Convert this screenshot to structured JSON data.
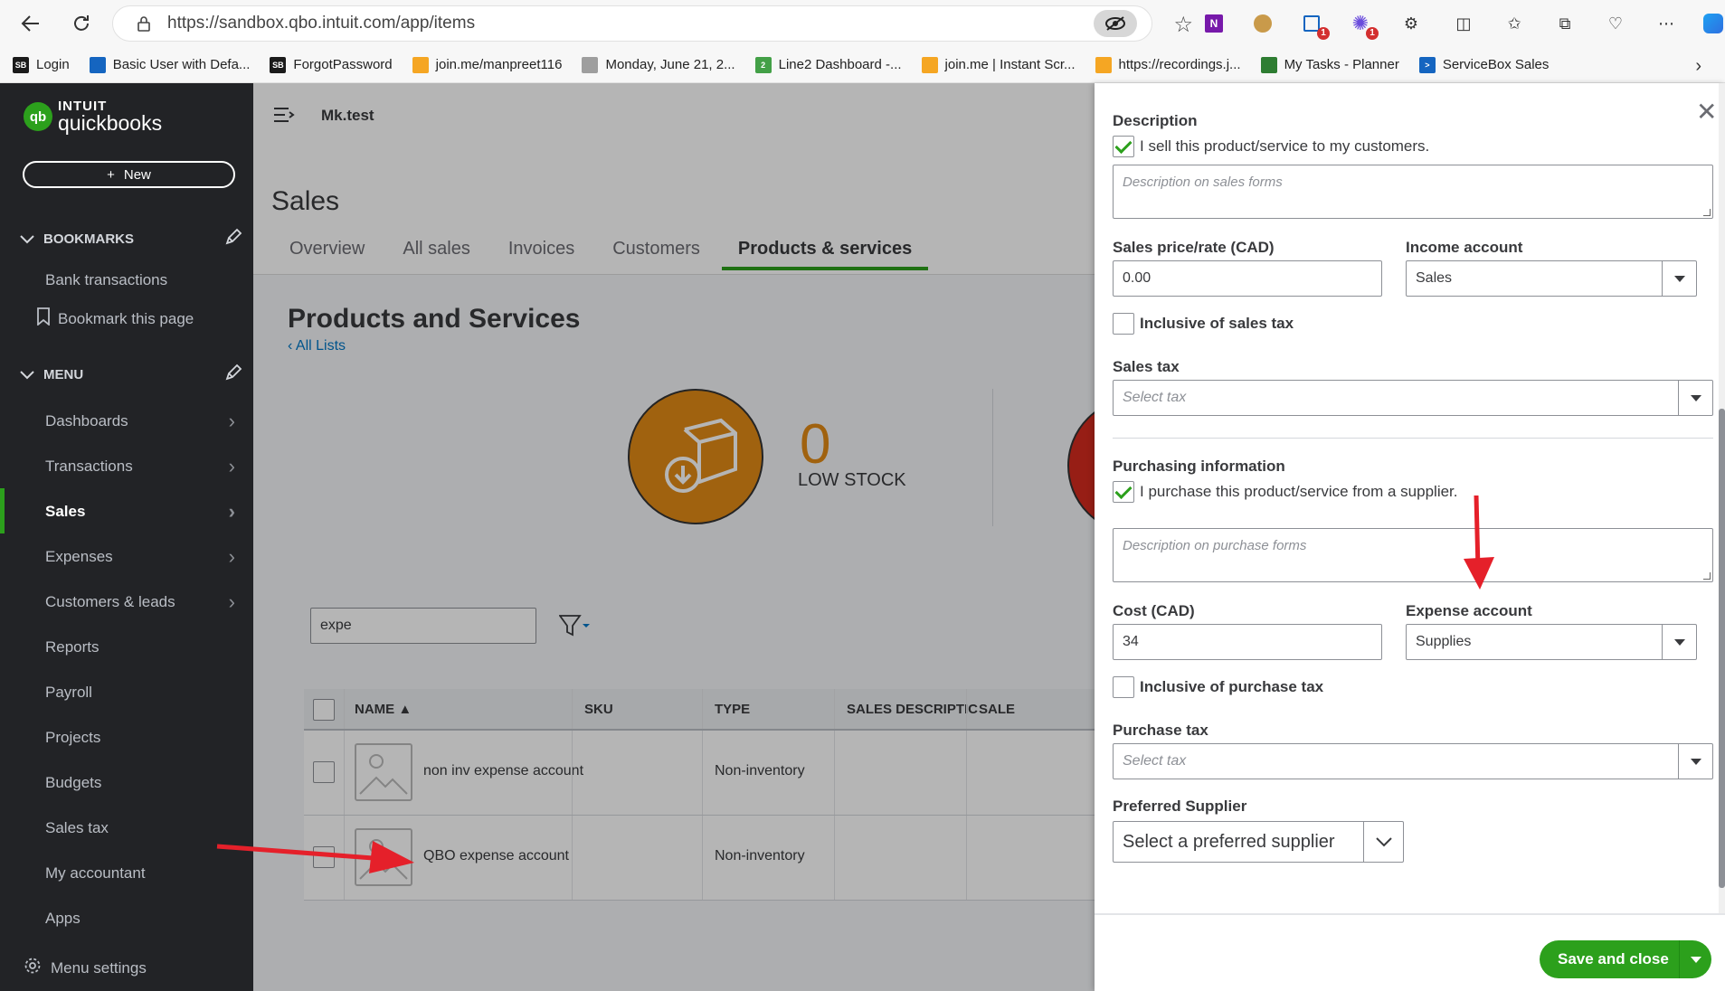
{
  "browser": {
    "url": "https://sandbox.qbo.intuit.com/app/items",
    "bookmarks": [
      {
        "label": "Login",
        "color": "#1b1b1b",
        "glyph": "SB"
      },
      {
        "label": "Basic User with Defa...",
        "color": "#1565c0",
        "glyph": ""
      },
      {
        "label": "ForgotPassword",
        "color": "#1b1b1b",
        "glyph": "SB"
      },
      {
        "label": "join.me/manpreet116",
        "color": "#f5a623",
        "glyph": ""
      },
      {
        "label": "Monday, June 21, 2...",
        "color": "#9e9e9e",
        "glyph": ""
      },
      {
        "label": "Line2 Dashboard -...",
        "color": "#43a047",
        "glyph": "2"
      },
      {
        "label": "join.me | Instant Scr...",
        "color": "#f5a623",
        "glyph": ""
      },
      {
        "label": "https://recordings.j...",
        "color": "#f5a623",
        "glyph": ""
      },
      {
        "label": "My Tasks - Planner",
        "color": "#2e7d32",
        "glyph": ""
      },
      {
        "label": "ServiceBox Sales",
        "color": "#1565c0",
        "glyph": ">"
      }
    ],
    "ext_badge_1": "1",
    "ext_badge_2": "1"
  },
  "sidebar": {
    "brand_top": "INTUIT",
    "brand_name": "quickbooks",
    "new_label": "New",
    "bookmarks_heading": "BOOKMARKS",
    "bookmark_items": [
      "Bank transactions",
      "Bookmark this page"
    ],
    "menu_heading": "MENU",
    "menu_items": [
      "Dashboards",
      "Transactions",
      "Sales",
      "Expenses",
      "Customers & leads",
      "Reports",
      "Payroll",
      "Projects",
      "Budgets",
      "Sales tax",
      "My accountant",
      "Apps"
    ],
    "menu_settings": "Menu settings"
  },
  "main": {
    "company": "Mk.test",
    "page_title": "Sales",
    "tabs": [
      "Overview",
      "All sales",
      "Invoices",
      "Customers",
      "Products & services"
    ],
    "section_title": "Products and Services",
    "all_lists": "All Lists",
    "low_stock_count": "0",
    "low_stock_label": "LOW STOCK",
    "search_value": "expe",
    "columns": [
      "NAME ▲",
      "SKU",
      "TYPE",
      "SALES DESCRIPTIC",
      "SALE"
    ],
    "rows": [
      {
        "name": "non inv expense account",
        "type": "Non-inventory"
      },
      {
        "name": "QBO expense account",
        "type": "Non-inventory"
      }
    ]
  },
  "drawer": {
    "description_label": "Description",
    "sell_checkbox": "I sell this product/service to my customers.",
    "sales_desc_placeholder": "Description on sales forms",
    "sales_price_label": "Sales price/rate (CAD)",
    "sales_price_value": "0.00",
    "income_account_label": "Income account",
    "income_account_value": "Sales",
    "inclusive_sales_tax": "Inclusive of sales tax",
    "sales_tax_label": "Sales tax",
    "sales_tax_placeholder": "Select tax",
    "purchasing_label": "Purchasing information",
    "purchase_checkbox": "I purchase this product/service from a supplier.",
    "purchase_desc_placeholder": "Description on purchase forms",
    "cost_label": "Cost (CAD)",
    "cost_value": "34",
    "expense_account_label": "Expense account",
    "expense_account_value": "Supplies",
    "inclusive_purchase_tax": "Inclusive of purchase tax",
    "purchase_tax_label": "Purchase tax",
    "purchase_tax_placeholder": "Select tax",
    "preferred_supplier_label": "Preferred Supplier",
    "preferred_supplier_placeholder": "Select a preferred supplier",
    "save_label": "Save and close"
  },
  "colors": {
    "brand_green": "#2ca01c",
    "sidebar_bg": "#222326",
    "annotation_red": "#e5202a",
    "low_stock_orange": "#e28a16"
  }
}
